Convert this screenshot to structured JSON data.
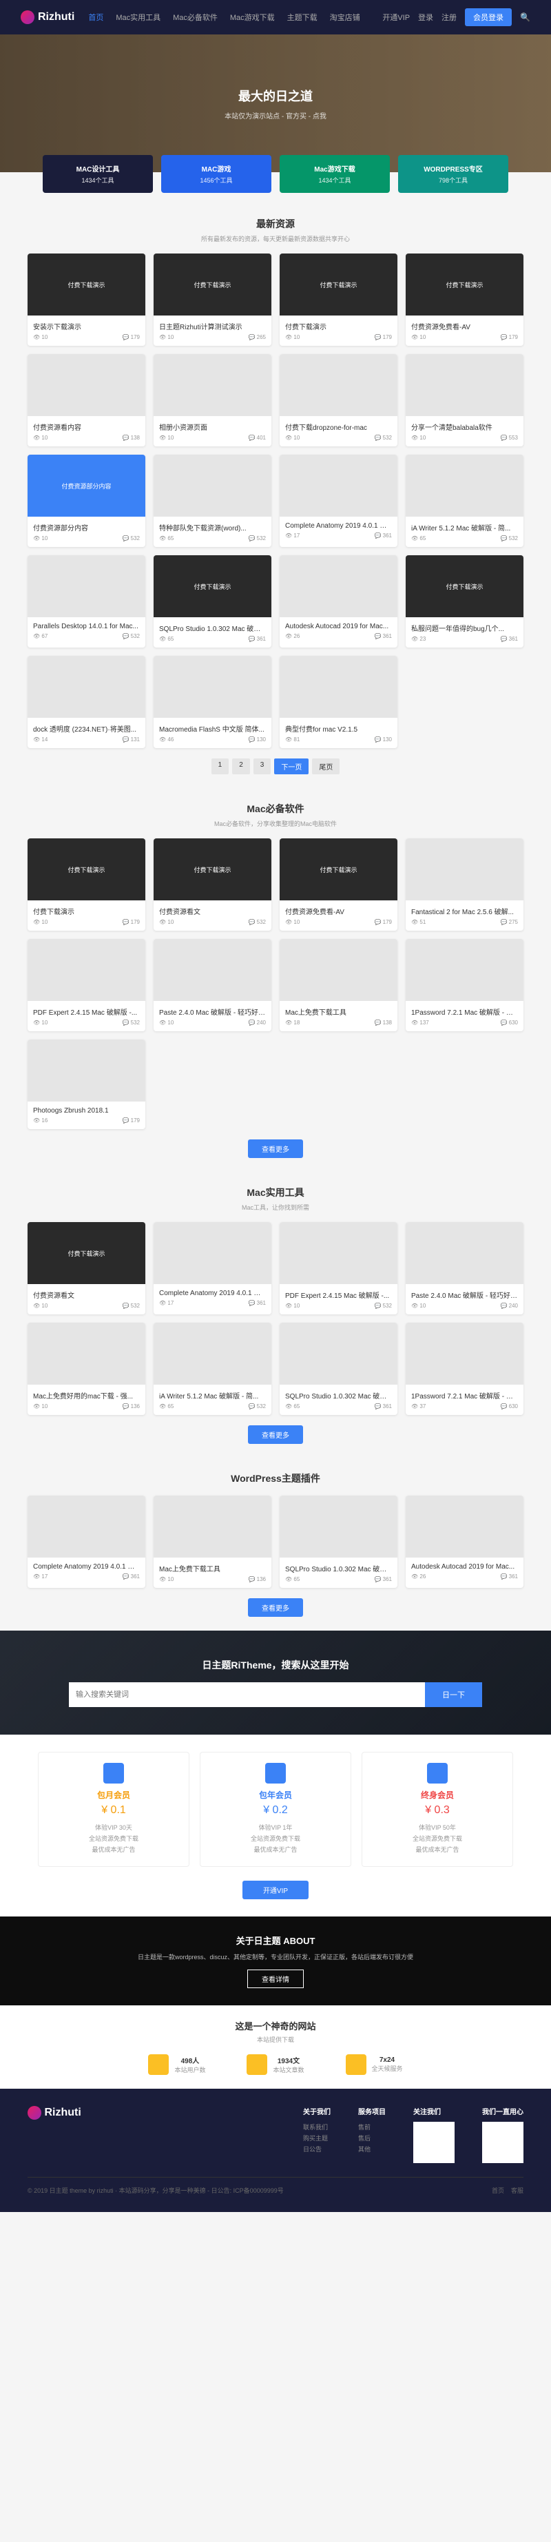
{
  "nav": {
    "logo": "Rizhuti",
    "menu": [
      "首页",
      "Mac实用工具",
      "Mac必备软件",
      "Mac游戏下载",
      "主题下载",
      "淘宝店铺"
    ],
    "right": [
      "开通VIP",
      "登录",
      "注册"
    ],
    "btn": "会员登录"
  },
  "hero": {
    "title": "最大的日之道",
    "sub": "本站仅为演示站点 - 官方买 - 点我"
  },
  "features": [
    {
      "t": "MAC设计工具",
      "s": "1434个工具"
    },
    {
      "t": "MAC游戏",
      "s": "1456个工具"
    },
    {
      "t": "Mac游戏下载",
      "s": "1434个工具"
    },
    {
      "t": "WORDPRESS专区",
      "s": "798个工具"
    }
  ],
  "sections": [
    {
      "title": "最新资源",
      "sub": "所有最新发布的资源，每天更新最新资源数据共享开心",
      "items": [
        {
          "t": "安装示下载演示",
          "m": "10·179",
          "img": "dark"
        },
        {
          "t": "日主题Rizhuti计算测试演示",
          "m": "10·265",
          "img": "dark"
        },
        {
          "t": "付费下载演示",
          "m": "10·179",
          "img": "dark"
        },
        {
          "t": "付费资源免费看-AV",
          "m": "10·179",
          "img": "dark"
        },
        {
          "t": "付费资源看内容",
          "m": "10·138",
          "img": "light"
        },
        {
          "t": "相册小资源页面",
          "m": "10·401",
          "img": "light"
        },
        {
          "t": "付费下载dropzone-for-mac",
          "m": "10·532",
          "img": "light"
        },
        {
          "t": "分享一个清楚balabala软件",
          "m": "10·553",
          "img": "light"
        },
        {
          "t": "付费资源部分内容",
          "m": "10·532",
          "img": "blue"
        },
        {
          "t": "特种部队免下载资源(word)...",
          "m": "65·532",
          "img": "light"
        },
        {
          "t": "Complete Anatomy 2019 4.0.1 Mac...",
          "m": "17·361",
          "img": "light"
        },
        {
          "t": "iA Writer 5.1.2 Mac 破解版 - 简...",
          "m": "65·532",
          "img": "light"
        },
        {
          "t": "Parallels Desktop 14.0.1 for Mac...",
          "m": "67·532",
          "img": "light"
        },
        {
          "t": "SQLPro Studio 1.0.302 Mac 破解版",
          "m": "65·361",
          "img": "dark"
        },
        {
          "t": "Autodesk Autocad 2019 for Mac...",
          "m": "26·361",
          "img": "light"
        },
        {
          "t": "私服问题一年值得的bug几个...",
          "m": "23·361",
          "img": "dark"
        },
        {
          "t": "dock 透明度 (2234.NET)·将美图...",
          "m": "14·131",
          "img": "light"
        },
        {
          "t": "Macromedia FlashS 中文版 简体...",
          "m": "46·130",
          "img": "light"
        },
        {
          "t": "典型付费for mac V2.1.5",
          "m": "81·130",
          "img": "light"
        }
      ],
      "pagination": [
        "1",
        "2",
        "3",
        "下一页",
        "尾页"
      ]
    },
    {
      "title": "Mac必备软件",
      "sub": "Mac必备软件，分享收集整理的Mac电脑软件",
      "items": [
        {
          "t": "付费下载演示",
          "m": "10·179",
          "img": "dark"
        },
        {
          "t": "付费资源看文",
          "m": "10·532",
          "img": "dark"
        },
        {
          "t": "付费资源免费看-AV",
          "m": "10·179",
          "img": "dark"
        },
        {
          "t": "Fantastical 2 for Mac 2.5.6 破解...",
          "m": "51·275",
          "img": "light"
        },
        {
          "t": "PDF Expert 2.4.15 Mac 破解版 -...",
          "m": "10·532",
          "img": "light"
        },
        {
          "t": "Paste 2.4.0 Mac 破解版 - 轻巧好用类...",
          "m": "10·240",
          "img": "light"
        },
        {
          "t": "Mac上免费下载工具",
          "m": "18·138",
          "img": "light"
        },
        {
          "t": "1Password 7.2.1 Mac 破解版 - 最...",
          "m": "137·630",
          "img": "light"
        },
        {
          "t": "Photoogs Zbrush 2018.1",
          "m": "16·179",
          "img": "light"
        }
      ],
      "btn": "查看更多"
    },
    {
      "title": "Mac实用工具",
      "sub": "Mac工具，让你找到所需",
      "items": [
        {
          "t": "付费资源看文",
          "m": "10·532",
          "img": "dark"
        },
        {
          "t": "Complete Anatomy 2019 4.0.1 Mac...",
          "m": "17·361",
          "img": "light"
        },
        {
          "t": "PDF Expert 2.4.15 Mac 破解版 -...",
          "m": "10·532",
          "img": "light"
        },
        {
          "t": "Paste 2.4.0 Mac 破解版 - 轻巧好用类...",
          "m": "10·240",
          "img": "light"
        },
        {
          "t": "Mac上免费好用的mac下载 - 强...",
          "m": "10·136",
          "img": "light"
        },
        {
          "t": "iA Writer 5.1.2 Mac 破解版 - 简...",
          "m": "65·532",
          "img": "light"
        },
        {
          "t": "SQLPro Studio 1.0.302 Mac 破解版",
          "m": "65·361",
          "img": "light"
        },
        {
          "t": "1Password 7.2.1 Mac 破解版 - 最...",
          "m": "37·630",
          "img": "light"
        }
      ],
      "btn": "查看更多"
    },
    {
      "title": "WordPress主题插件",
      "sub": "",
      "items": [
        {
          "t": "Complete Anatomy 2019 4.0.1 Mac...",
          "m": "17·361",
          "img": "light"
        },
        {
          "t": "Mac上免费下载工具",
          "m": "10·136",
          "img": "light"
        },
        {
          "t": "SQLPro Studio 1.0.302 Mac 破解版",
          "m": "65·361",
          "img": "light"
        },
        {
          "t": "Autodesk Autocad 2019 for Mac...",
          "m": "26·361",
          "img": "light"
        }
      ],
      "btn": "查看更多"
    }
  ],
  "search": {
    "title": "日主题RiTheme，搜索从这里开始",
    "placeholder": "输入搜索关键词",
    "btn": "日一下"
  },
  "vip": {
    "cards": [
      {
        "t": "包月会员",
        "p": "¥ 0.1",
        "f": [
          "体验VIP 30天",
          "全站资源免费下载",
          "最优成本无广告"
        ]
      },
      {
        "t": "包年会员",
        "p": "¥ 0.2",
        "f": [
          "体验VIP 1年",
          "全站资源免费下载",
          "最优成本无广告"
        ]
      },
      {
        "t": "终身会员",
        "p": "¥ 0.3",
        "f": [
          "体验VIP 50年",
          "全站资源免费下载",
          "最优成本无广告"
        ]
      }
    ],
    "btn": "开通VIP"
  },
  "about": {
    "title": "关于日主题 ABOUT",
    "sub": "日主题是一款wordpress、discuz、其他定制等，专业团队开发，正保证正版，各站后端发布订很方便",
    "btn": "查看详情"
  },
  "stats": {
    "title": "这是一个神奇的网站",
    "sub": "本站提供下载",
    "items": [
      {
        "n": "498人",
        "l": "本站用户数"
      },
      {
        "n": "1934文",
        "l": "本站文章数"
      },
      {
        "n": "7x24",
        "l": "全天候服务"
      }
    ]
  },
  "footer": {
    "cols": [
      {
        "t": "关于我们",
        "links": [
          "联系我们",
          "购买主题",
          "日公告"
        ]
      },
      {
        "t": "服务项目",
        "links": [
          "售前",
          "售后",
          "其他"
        ]
      },
      "关注我们",
      "我们一直用心"
    ],
    "copyright": "© 2019 日主题 theme by rizhuti · 本站源码分享，分享是一种美德 - 日公告: ICP备00009999号",
    "links": [
      "首页",
      "客服"
    ]
  }
}
